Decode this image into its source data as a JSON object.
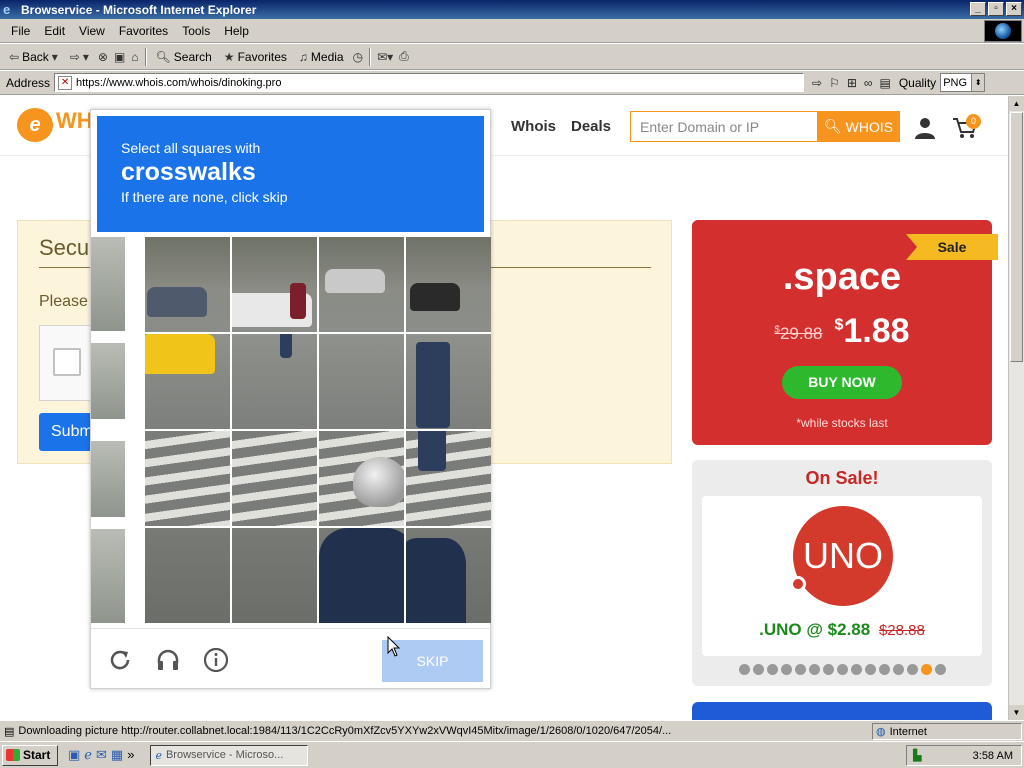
{
  "window": {
    "title": "Browservice - Microsoft Internet Explorer",
    "controls": [
      "_",
      "▫",
      "×"
    ]
  },
  "menu": [
    "File",
    "Edit",
    "View",
    "Favorites",
    "Tools",
    "Help"
  ],
  "toolbar": {
    "back": "Back",
    "search": "Search",
    "favorites": "Favorites",
    "media": "Media"
  },
  "address": {
    "label": "Address",
    "url": "https://www.whois.com/whois/dinoking.pro",
    "quality_label": "Quality",
    "quality_value": "PNG"
  },
  "site": {
    "logo_text": "WH",
    "nav": [
      "y",
      "Whois",
      "Deals"
    ],
    "search_placeholder": "Enter Domain or IP",
    "search_button": "WHOIS",
    "cart_count": "0"
  },
  "security": {
    "title": "Secu",
    "prompt": "Please",
    "submit": "Subm"
  },
  "sale_card": {
    "ribbon": "Sale",
    "tld": ".space",
    "old_currency": "$",
    "old_price": "29.88",
    "new_currency": "$",
    "new_price": "1.88",
    "button": "BUY NOW",
    "note": "*while stocks last"
  },
  "onsale_card": {
    "title": "On Sale!",
    "logo_text": "UNO",
    "price": ".UNO @ $2.88",
    "old_price": "$28.88",
    "dot_count": 15,
    "active_dot": 13
  },
  "captcha": {
    "instruction": "Select all squares with",
    "keyword": "crosswalks",
    "hint": "If there are none, click skip",
    "skip_button": "SKIP",
    "footer_icons": [
      "reload-icon",
      "headphones-icon",
      "info-icon"
    ]
  },
  "status": {
    "text": "Downloading picture http://router.collabnet.local:1984/113/1C2CcRy0mXfZcv5YXYw2xVWqvI45Mitx/image/1/2608/0/1020/647/2054/...",
    "zone": "Internet"
  },
  "taskbar": {
    "start": "Start",
    "task": "Browservice - Microso...",
    "time": "3:58 AM"
  },
  "colors": {
    "captcha_blue": "#1a73e8",
    "whois_orange": "#f7941d",
    "sale_red": "#d32f2f",
    "buy_green": "#2eb82e"
  }
}
